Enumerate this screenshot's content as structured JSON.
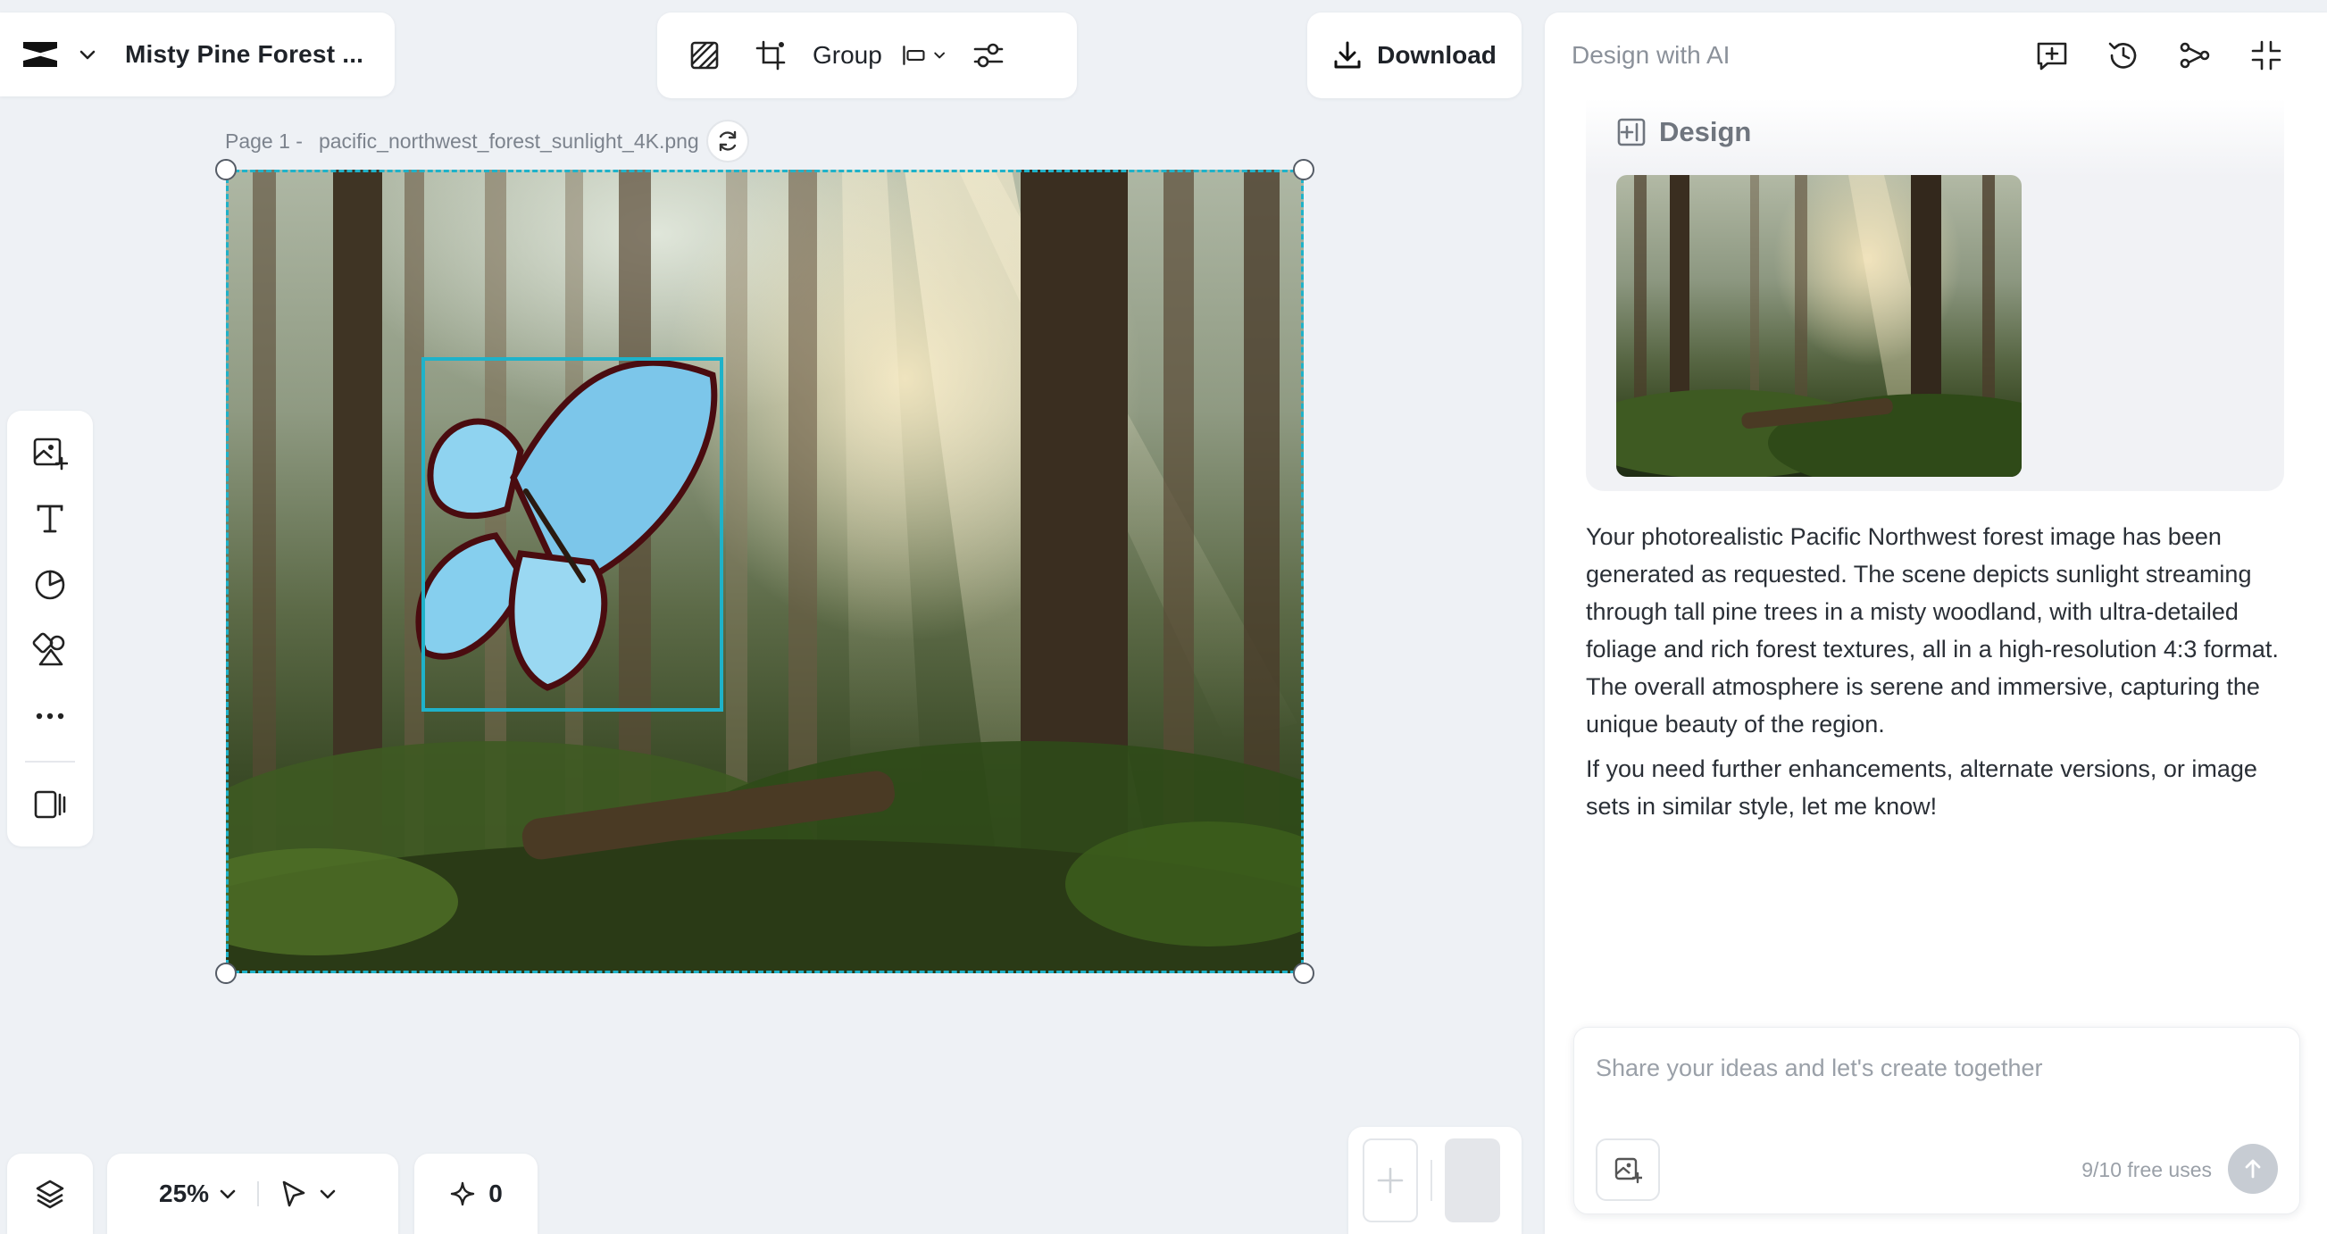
{
  "project": {
    "title": "Misty Pine Forest ...",
    "logo_icon": "capcut-logo-icon",
    "menu_icon": "chevron-down-icon"
  },
  "toolbar": {
    "items": [
      {
        "name": "transparency-icon"
      },
      {
        "name": "crop-icon"
      }
    ],
    "group_label": "Group",
    "align_icon": "align-left-icon",
    "adjust_icon": "sliders-icon"
  },
  "download": {
    "label": "Download",
    "icon": "download-icon"
  },
  "canvas": {
    "page_label": "Page 1 -",
    "file_name": "pacific_northwest_forest_sunlight_4K.png",
    "selection_color": "#1fb2c9"
  },
  "left_rail": {
    "tools": [
      "add-image-icon",
      "text-icon",
      "shapes-icon",
      "elements-icon",
      "more-icon",
      "panel-toggle-icon"
    ]
  },
  "bottom": {
    "zoom": "25%",
    "credits": "0"
  },
  "ai_panel": {
    "title": "Design with AI",
    "actions": [
      "new-chat-icon",
      "history-icon",
      "share-icon",
      "collapse-icon"
    ],
    "card_title": "Design",
    "message": [
      "Your photorealistic Pacific Northwest forest image has been generated as requested. The scene depicts sunlight streaming through tall pine trees in a misty woodland, with ultra-detailed foliage and rich forest textures, all in a high-resolution 4:3 format. The overall atmosphere is serene and immersive, capturing the unique beauty of the region.",
      "If you need further enhancements, alternate versions, or image sets in similar style, let me know!"
    ],
    "prompt_placeholder": "Share your ideas and let's create together",
    "free_uses": "9/10 free uses"
  },
  "colors": {
    "accent": "#1fb2c9",
    "background": "#eef1f5"
  }
}
